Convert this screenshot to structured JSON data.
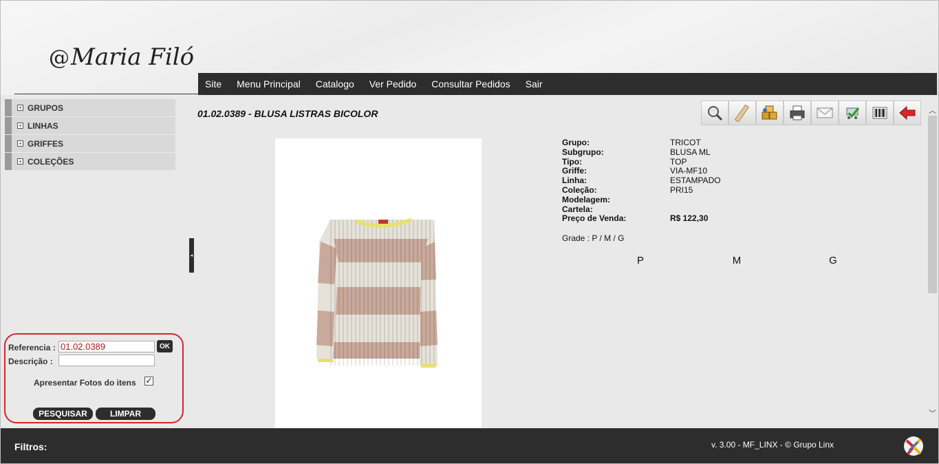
{
  "brand": {
    "logo_text": "Maria Filó",
    "logo_swirl": "@"
  },
  "nav": {
    "items": [
      "Site",
      "Menu Principal",
      "Catalogo",
      "Ver Pedido",
      "Consultar Pedidos",
      "Sair"
    ]
  },
  "sidebar": {
    "items": [
      {
        "label": "GRUPOS"
      },
      {
        "label": "LINHAS"
      },
      {
        "label": "GRIFFES"
      },
      {
        "label": "COLEÇÕES"
      }
    ]
  },
  "product": {
    "title": "01.02.0389 - BLUSA LISTRAS BICOLOR",
    "details": [
      {
        "key": "Grupo:",
        "value": "TRICOT"
      },
      {
        "key": "Subgrupo:",
        "value": "BLUSA ML"
      },
      {
        "key": "Tipo:",
        "value": "TOP"
      },
      {
        "key": "Griffe:",
        "value": "VIA-MF10"
      },
      {
        "key": "Linha:",
        "value": "ESTAMPADO"
      },
      {
        "key": "Coleção:",
        "value": "PRI15"
      },
      {
        "key": "Modelagem:",
        "value": ""
      },
      {
        "key": "Cartela:",
        "value": ""
      },
      {
        "key": "Preço de Venda:",
        "value": "R$ 122,30"
      }
    ],
    "grade": "Grade : P / M / G",
    "sizes": [
      "P",
      "M",
      "G"
    ],
    "photo_colors": {
      "stripe_a": "#c9a99a",
      "stripe_b": "#e6e2d9",
      "trim": "#e9e06a"
    }
  },
  "toolbar": {
    "icons": [
      "magnifier-icon",
      "ruler-icon",
      "boxes-icon",
      "printer-icon",
      "mail-icon",
      "cart-check-icon",
      "barcode-icon",
      "back-arrow-icon"
    ]
  },
  "search": {
    "ref_label": "Referencia :",
    "ref_value": "01.02.0389",
    "ok_label": "OK",
    "desc_label": "Descrição  :",
    "desc_value": "",
    "photos_label": "Apresentar Fotos do itens",
    "photos_checked": "✓",
    "search_label": "PESQUISAR",
    "clear_label": "LIMPAR"
  },
  "footer": {
    "filters_label": "Filtros:",
    "version": "v. 3.00 - MF_LINX - © Grupo Linx"
  },
  "colors": {
    "accent_red": "#d9252b",
    "dark_bar": "#2d2d2d",
    "value_red": "#b01a1a"
  }
}
